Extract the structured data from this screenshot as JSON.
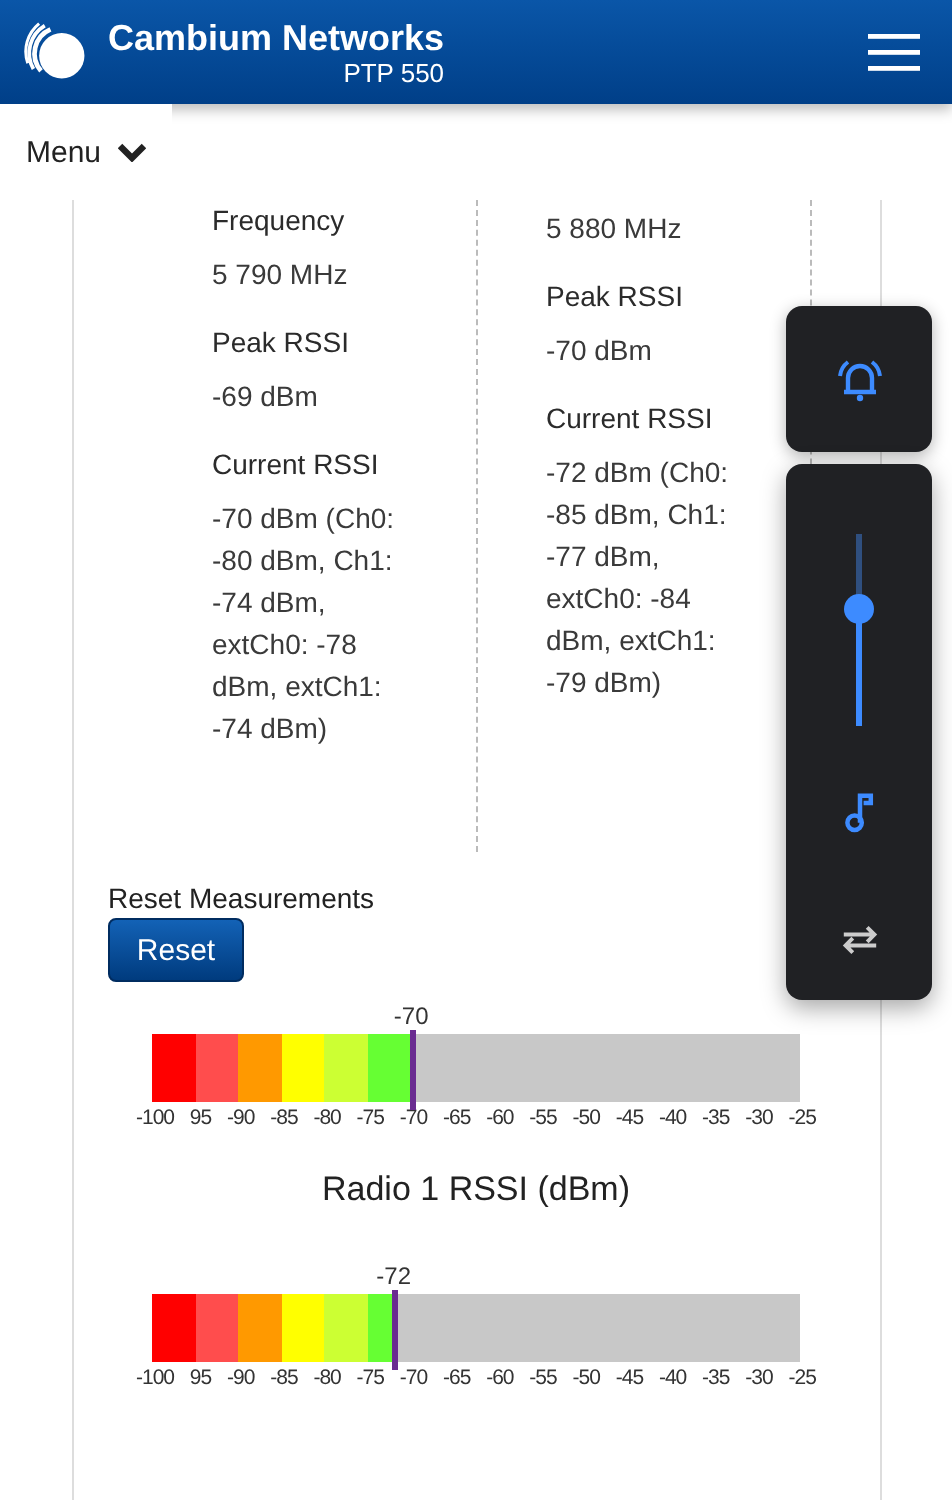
{
  "header": {
    "brand": "Cambium Networks",
    "product": "PTP 550"
  },
  "menu": {
    "label": "Menu"
  },
  "columns": [
    {
      "items": [
        {
          "kind": "label",
          "text": "Frequency"
        },
        {
          "kind": "value",
          "text": "5 790 MHz"
        },
        {
          "kind": "label",
          "text": "Peak RSSI"
        },
        {
          "kind": "value",
          "text": "-69 dBm"
        },
        {
          "kind": "label",
          "text": "Current RSSI"
        },
        {
          "kind": "value",
          "text": "-70 dBm (Ch0: -80 dBm, Ch1: -74 dBm, extCh0: -78 dBm, extCh1: -74 dBm)"
        }
      ]
    },
    {
      "items": [
        {
          "kind": "value",
          "text": "5 880 MHz"
        },
        {
          "kind": "label",
          "text": "Peak RSSI"
        },
        {
          "kind": "value",
          "text": "-70 dBm"
        },
        {
          "kind": "label",
          "text": "Current RSSI"
        },
        {
          "kind": "value",
          "text": "-72 dBm (Ch0: -85 dBm, Ch1: -77 dBm, extCh0: -84 dBm, extCh1: -79 dBm)"
        }
      ]
    }
  ],
  "reset": {
    "label": "Reset Measurements",
    "button": "Reset"
  },
  "gauges": [
    {
      "reading": "-70",
      "level": 0.4,
      "ticks": [
        "-100",
        "95",
        "-90",
        "-85",
        "-80",
        "-75",
        "-70",
        "-65",
        "-60",
        "-55",
        "-50",
        "-45",
        "-40",
        "-35",
        "-30",
        "-25"
      ],
      "title": "Radio 1 RSSI (dBm)"
    },
    {
      "reading": "-72",
      "level": 0.373,
      "ticks": [
        "-100",
        "95",
        "-90",
        "-85",
        "-80",
        "-75",
        "-70",
        "-65",
        "-60",
        "-55",
        "-50",
        "-45",
        "-40",
        "-35",
        "-30",
        "-25"
      ]
    }
  ],
  "volume_panel": {
    "level": 0.61
  }
}
